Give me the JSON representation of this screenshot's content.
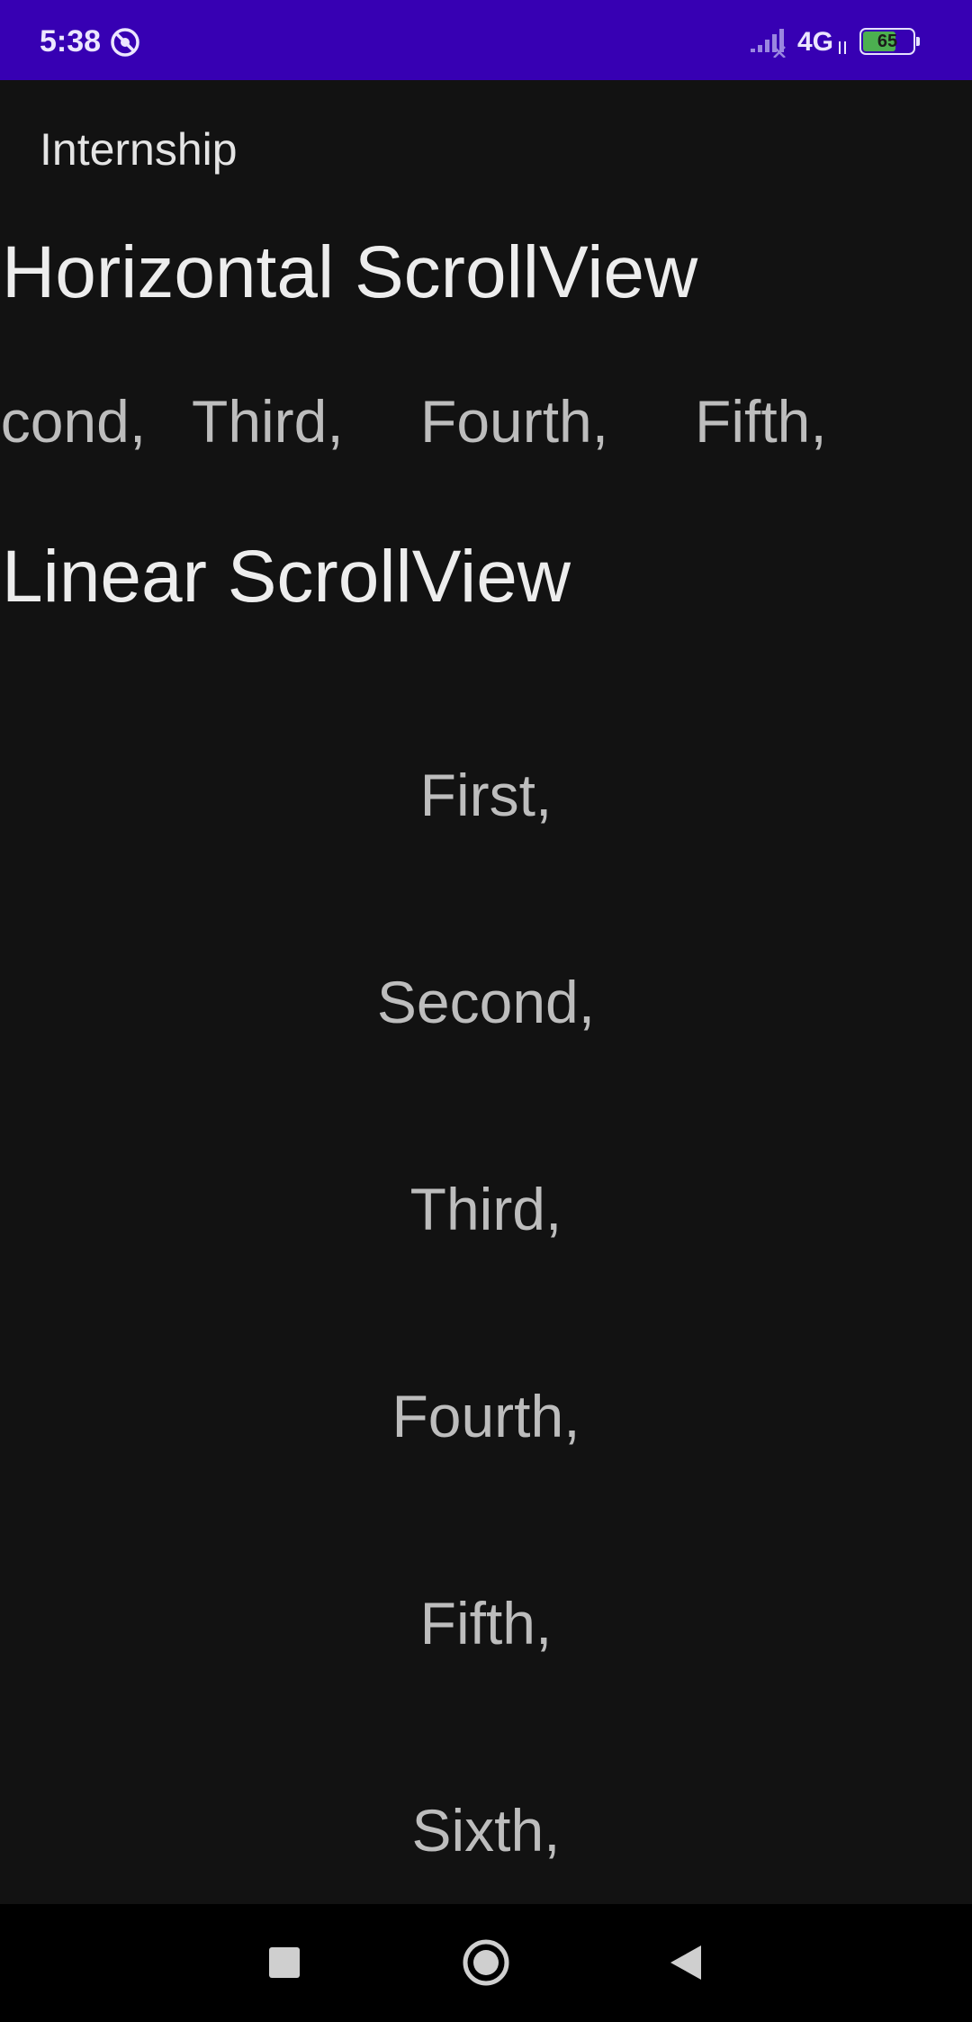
{
  "status_bar": {
    "time": "5:38",
    "network_type": "4G",
    "battery_level": "65",
    "icons": [
      "do-not-disturb-icon",
      "signal-icon",
      "network-arrows-icon",
      "battery-icon"
    ]
  },
  "app_bar": {
    "title": "Internship"
  },
  "horizontal_section": {
    "title": "Horizontal ScrollView",
    "items": [
      "Second,",
      "Third,",
      "Fourth,",
      "Fifth,"
    ]
  },
  "vertical_section": {
    "title": "Linear ScrollView",
    "items": [
      "First,",
      "Second,",
      "Third,",
      "Fourth,",
      "Fifth,",
      "Sixth,"
    ]
  },
  "nav_bar": {
    "icons": [
      "recents-icon",
      "home-icon",
      "back-icon"
    ]
  },
  "colors": {
    "status_bar": "#3700B3",
    "background": "#121212",
    "title_text": "#EDEDED",
    "item_text": "#BDBDBD",
    "nav_bar": "#000000",
    "battery_fill": "#4CAF50"
  }
}
